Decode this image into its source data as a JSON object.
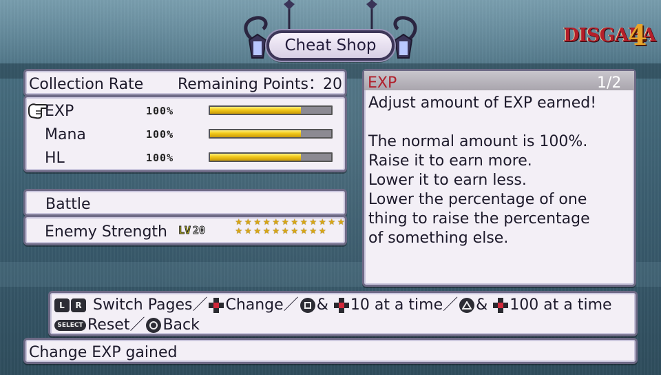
{
  "header": {
    "title": "Cheat Shop",
    "logo_text": "DISGAEA",
    "logo_number": "4"
  },
  "collection": {
    "label": "Collection Rate",
    "remaining_label": "Remaining Points：",
    "remaining_value": "20",
    "items": [
      {
        "label": "EXP",
        "percent_text": "100%",
        "fill": 0.75
      },
      {
        "label": "Mana",
        "percent_text": "100%",
        "fill": 0.75
      },
      {
        "label": "HL",
        "percent_text": "100%",
        "fill": 0.75
      }
    ]
  },
  "battle": {
    "label": "Battle",
    "enemy_strength_label": "Enemy Strength",
    "lv_label": "LV",
    "lv_value": "20",
    "stars_total": 22,
    "stars_filled": 22
  },
  "description": {
    "title": "EXP",
    "page": "1/2",
    "lines": [
      "Adjust amount of EXP earned!",
      "",
      "The normal amount is 100%.",
      "Raise it to earn more.",
      "Lower it to earn less.",
      "Lower the percentage of one",
      "thing to raise the percentage",
      "of something else."
    ]
  },
  "controls": {
    "l_button": "L",
    "r_button": "R",
    "switch_pages": "Switch Pages／",
    "change": "Change／",
    "amp1": "&",
    "ten_at_a_time": "10 at a time／",
    "amp2": "&",
    "hundred_at_a_time": "100 at a time",
    "select_button": "SELECT",
    "reset": "Reset／",
    "back": "Back"
  },
  "status": {
    "message": "Change EXP gained"
  },
  "colors": {
    "bar_fill": "#f2c819",
    "desc_title": "#b0202c",
    "panel_bg": "#f3eff6"
  }
}
